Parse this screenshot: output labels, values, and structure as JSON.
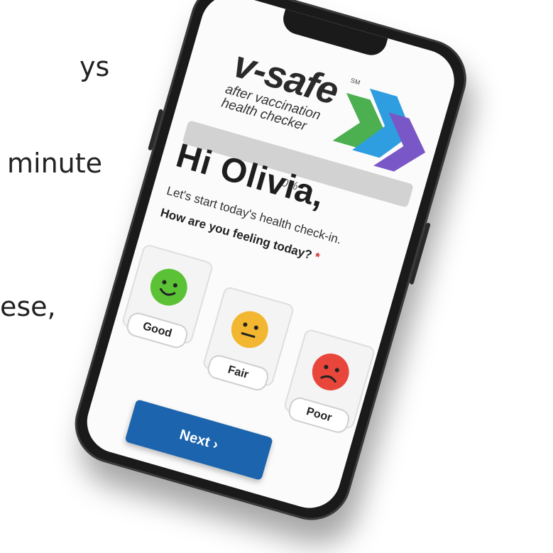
{
  "background": {
    "fragments": [
      "ys",
      "minute",
      "ese,"
    ]
  },
  "app": {
    "logo_word": "v-safe",
    "logo_mark": "SM",
    "logo_sub": "after vaccination health checker"
  },
  "progress": {
    "label": "0%",
    "value": 0
  },
  "greeting": "Hi Olivia,",
  "subtitle": "Let's start today's health check-in.",
  "question": "How are you feeling today?",
  "required_mark": "*",
  "options": [
    {
      "label": "Good",
      "color": "#5bc236"
    },
    {
      "label": "Fair",
      "color": "#f2b630"
    },
    {
      "label": "Poor",
      "color": "#e8463b"
    }
  ],
  "next_button": "Next  ›",
  "colors": {
    "accent": "#1c64ad",
    "chevron_green": "#4caf50",
    "chevron_blue": "#2f9ee0",
    "chevron_purple": "#7a57c6"
  }
}
